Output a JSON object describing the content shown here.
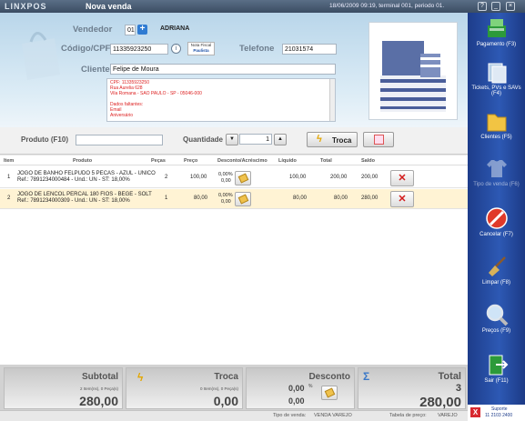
{
  "titlebar": {
    "logo": "LINXPOS",
    "title": "Nova venda",
    "info": "18/06/2009 09:19, terminal 001, periodo 01."
  },
  "header": {
    "vendedor_label": "Vendedor",
    "vendedor_value": "01",
    "vendedor_name": "ADRIANA",
    "cpf_label": "Código/CPF",
    "cpf_value": "11335923250",
    "nota_line1": "Nota Fiscal",
    "nota_line2": "Paulista",
    "telefone_label": "Telefone",
    "telefone_value": "21031574",
    "cliente_label": "Cliente",
    "cliente_value": "Felipe de Moura",
    "info_lines": [
      "CPF: 11335923250",
      "Rua Aurelia 628",
      "Vila Romana - SAO PAULO - SP - 05046-000",
      "",
      "Dados faltantes:",
      "Email",
      "Aniversário"
    ]
  },
  "product_bar": {
    "produto_label": "Produto (F10)",
    "produto_value": "",
    "quantidade_label": "Quantidade",
    "quantidade_value": "1",
    "troca_label": "Troca"
  },
  "grid": {
    "headers": [
      "Item",
      "Produto",
      "Peças",
      "Preço",
      "Desconto/Acréscimo",
      "Líquido",
      "Total",
      "Saldo"
    ],
    "rows": [
      {
        "item": "1",
        "name": "JOGO DE BANHO FELPUDO 5 PECAS - AZUL - UNICO",
        "ref": "Ref.: 7891234000484 - Und.: UN - ST: 18,00%",
        "pecas": "2",
        "preco": "100,00",
        "desc1": "0,00%",
        "desc2": "0,00",
        "liquido": "100,00",
        "total": "200,00",
        "saldo": "200,00"
      },
      {
        "item": "2",
        "name": "JOGO DE LENCOL PERCAL 180 FIOS - BEGE - SOLT",
        "ref": "Ref.: 7891234000309 - Und.: UN - ST: 18,00%",
        "pecas": "1",
        "preco": "80,00",
        "desc1": "0,00%",
        "desc2": "0,00",
        "liquido": "80,00",
        "total": "80,00",
        "saldo": "280,00"
      }
    ]
  },
  "totals": {
    "subtotal_label": "Subtotal",
    "subtotal_sub": "2 Item(ns), 0 Peça(s)",
    "subtotal_value": "280,00",
    "troca_label": "Troca",
    "troca_sub": "0 Item(ns), 0 Peça(s)",
    "troca_value": "0,00",
    "desconto_label": "Desconto",
    "desconto_pct": "0,00",
    "desconto_pct_sign": "%",
    "desconto_value": "0,00",
    "total_label": "Total",
    "total_count": "3",
    "total_value": "280,00"
  },
  "status": {
    "tipo_label": "Tipo de venda:",
    "tipo_value": "VENDA VAREJO",
    "tabela_label": "Tabela de preço:",
    "tabela_value": "VAREJO"
  },
  "sidebar": {
    "items": [
      {
        "label": "Pagamento (F3)",
        "icon": "cash-register-icon"
      },
      {
        "label": "Tickets, PVs e SAVs (F4)",
        "icon": "tickets-icon"
      },
      {
        "label": "Clientes (F5)",
        "icon": "folder-icon"
      },
      {
        "label": "Tipo de venda (F6)",
        "icon": "shirt-icon"
      },
      {
        "label": "Cancelar (F7)",
        "icon": "cancel-icon"
      },
      {
        "label": "Limpar (F8)",
        "icon": "broom-icon"
      },
      {
        "label": "Preços (F9)",
        "icon": "magnifier-icon"
      },
      {
        "label": "Sair (F11)",
        "icon": "exit-door-icon"
      }
    ],
    "support_label": "Suporte",
    "support_phone": "11 2103 2400"
  }
}
